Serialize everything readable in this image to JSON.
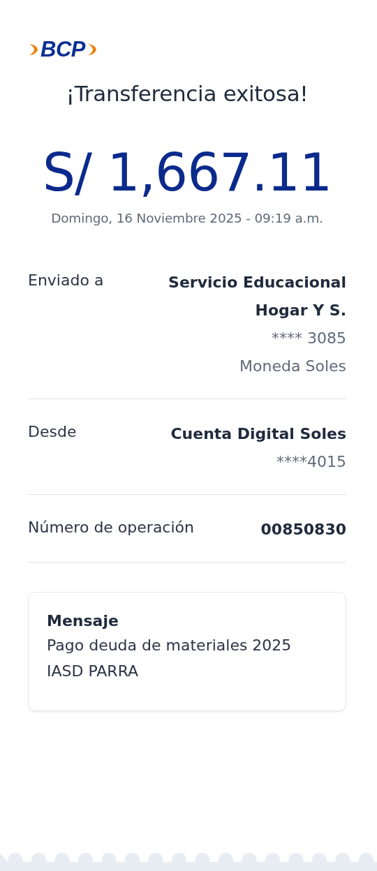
{
  "brand": "BCP",
  "title": "¡Transferencia exitosa!",
  "amount": "S/ 1,667.11",
  "date": "Domingo, 16 Noviembre 2025 - 09:19 a.m.",
  "details": [
    {
      "label": "Enviado a",
      "lines": [
        {
          "text": "Servicio Educacional Hogar Y S.",
          "kind": "strong"
        },
        {
          "text": "**** 3085",
          "kind": "muted"
        },
        {
          "text": "Moneda Soles",
          "kind": "muted"
        }
      ]
    },
    {
      "label": "Desde",
      "lines": [
        {
          "text": "Cuenta Digital Soles",
          "kind": "strong"
        },
        {
          "text": "****4015",
          "kind": "muted"
        }
      ]
    },
    {
      "label": "Número de operación",
      "lines": [
        {
          "text": "00850830",
          "kind": "strong"
        }
      ]
    }
  ],
  "message": {
    "title": "Mensaje",
    "text": "Pago deuda de materiales 2025 IASD PARRA"
  }
}
